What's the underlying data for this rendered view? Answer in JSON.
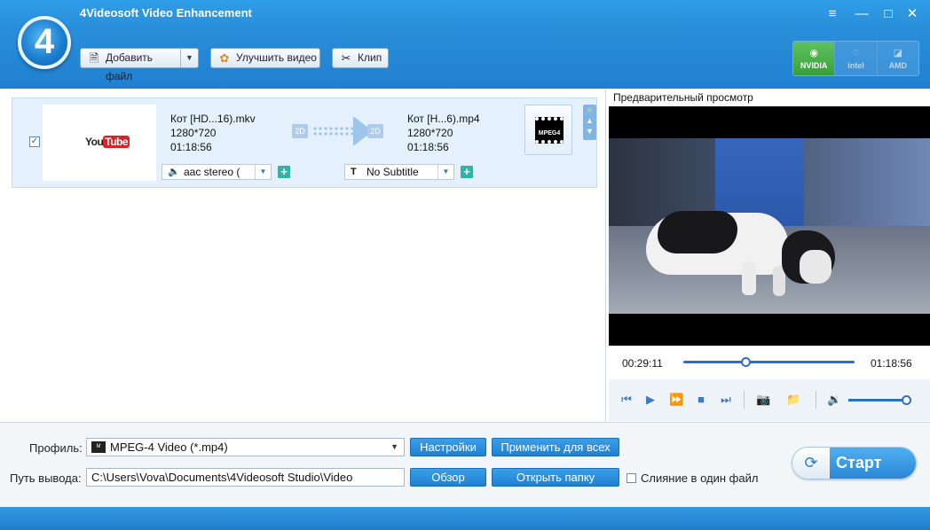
{
  "app": {
    "title": "4Videosoft Video Enhancement",
    "logo_text": "4"
  },
  "window": {
    "menu_icon": "≡",
    "minimize": "—",
    "maximize": "□",
    "close": "✕"
  },
  "toolbar": {
    "add_file": "Добавить файл",
    "enhance": "Улучшить видео",
    "clip": "Клип"
  },
  "accel": {
    "nvidia": "NVIDIA",
    "intel": "intel",
    "amd": "AMD"
  },
  "file": {
    "thumb_you": "You",
    "thumb_tube": "Tube",
    "src_name": "Кот [HD...16).mkv",
    "src_res": "1280*720",
    "src_dur": "01:18:56",
    "dst_name": "Кот [H...6).mp4",
    "dst_res": "1280*720",
    "dst_dur": "01:18:56",
    "badge_in": "2D",
    "badge_out": "2D",
    "audio": "aac stereo (",
    "subtitle": "No Subtitle",
    "format_label": "MPEG4"
  },
  "preview": {
    "label": "Предварительный просмотр",
    "time_current": "00:29:11",
    "time_total": "01:18:56",
    "progress": 0.37,
    "volume": 1.0
  },
  "bottom": {
    "profile_label": "Профиль:",
    "profile_value": "MPEG-4 Video (*.mp4)",
    "settings": "Настройки",
    "apply_all": "Применить для всех",
    "output_label": "Путь вывода:",
    "output_value": "C:\\Users\\Vova\\Documents\\4Videosoft Studio\\Video",
    "browse": "Обзор",
    "open_folder": "Открыть папку",
    "merge": "Слияние в один файл",
    "start": "Старт"
  }
}
